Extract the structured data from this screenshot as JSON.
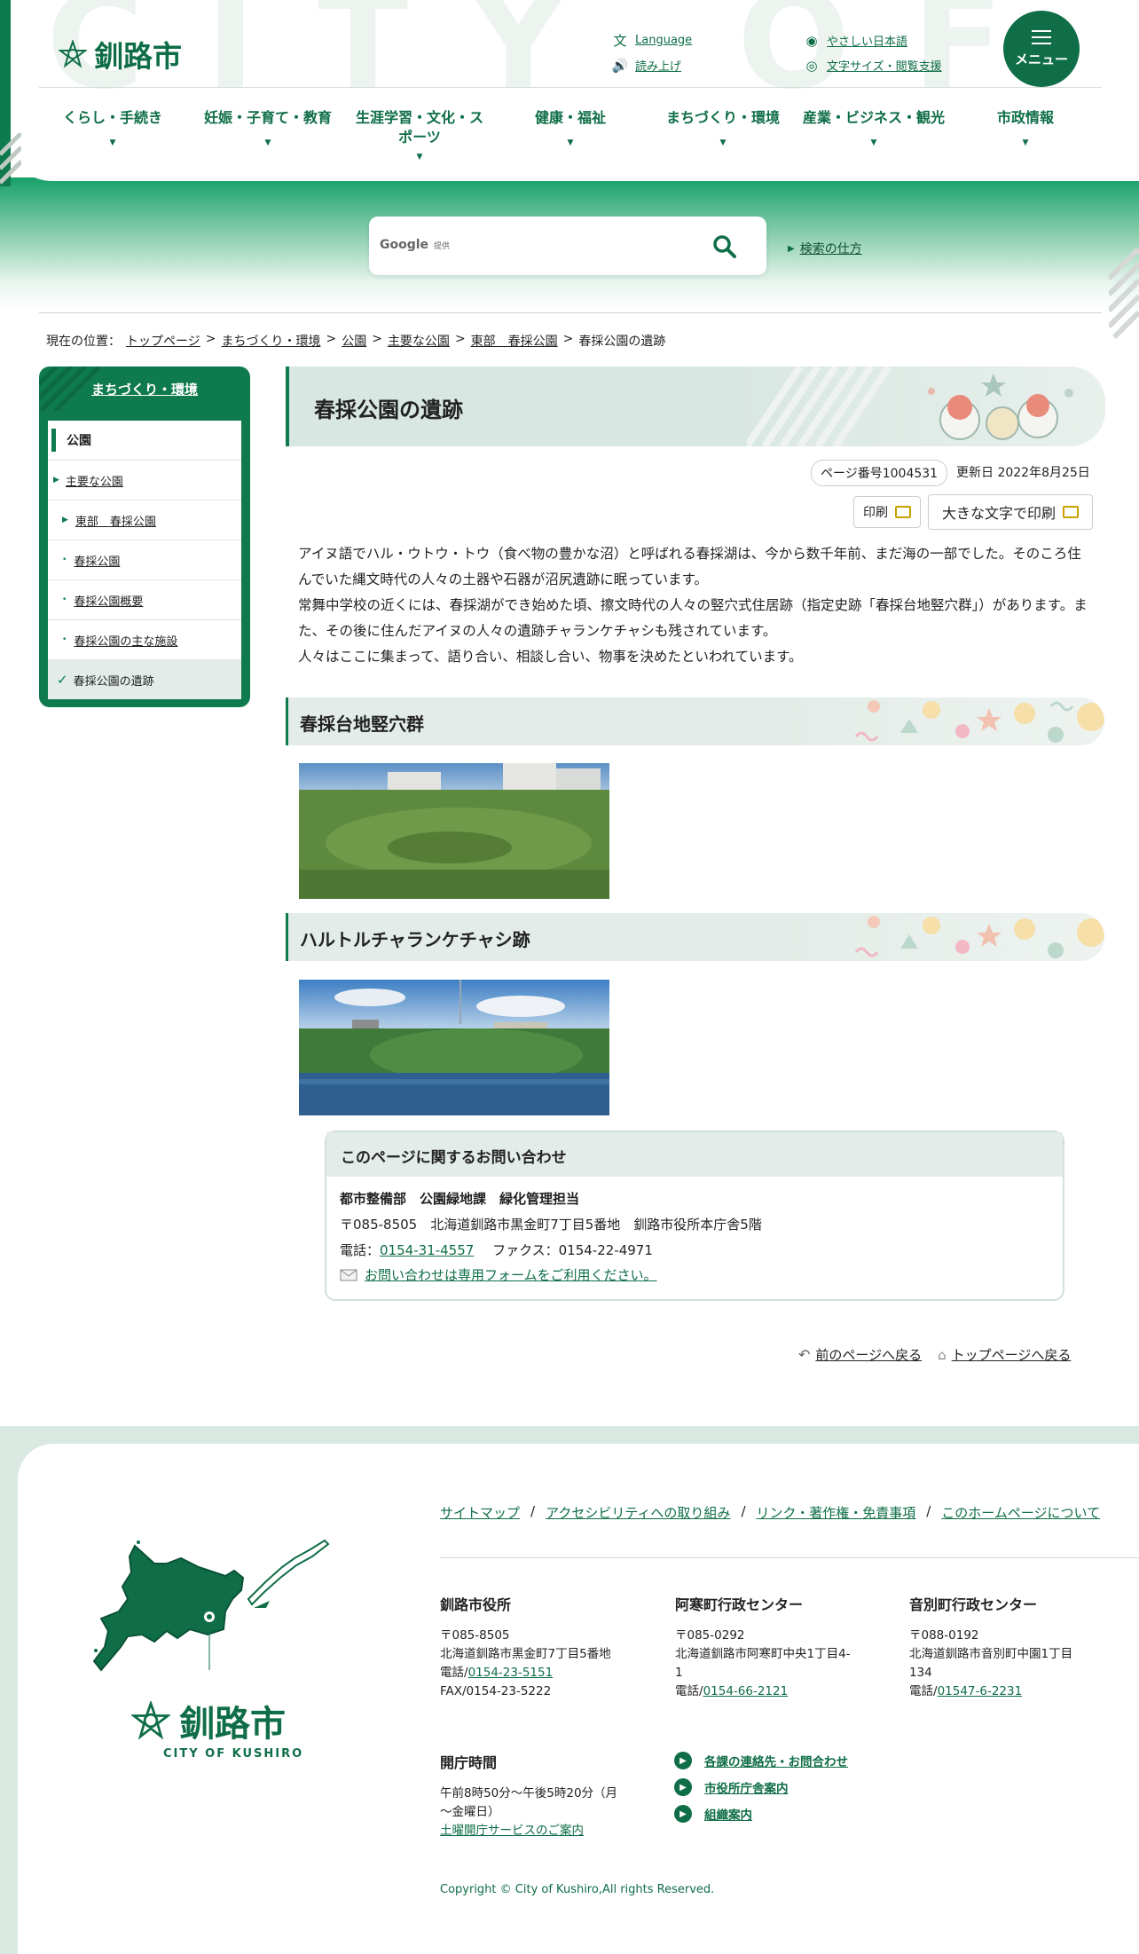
{
  "header": {
    "watermark": "CITY OF KUSHIRO",
    "logo_text": "釧路市",
    "language": "Language",
    "read_aloud": "読み上げ",
    "easy_japanese": "やさしい日本語",
    "font_size": "文字サイズ・閲覧支援",
    "menu_label": "メニュー"
  },
  "nav": [
    "くらし・手続き",
    "妊娠・子育て・教育",
    "生涯学習・文化・スポーツ",
    "健康・福祉",
    "まちづくり・環境",
    "産業・ビジネス・観光",
    "市政情報"
  ],
  "search": {
    "google": "Google",
    "provided": "提供",
    "how_to": "検索の仕方"
  },
  "breadcrumb": {
    "prefix": "現在の位置：",
    "items": [
      "トップページ",
      "まちづくり・環境",
      "公園",
      "主要な公園",
      "東部　春採公園"
    ],
    "current": "春採公園の遺跡"
  },
  "sidebar": {
    "title": "まちづくり・環境",
    "items": [
      {
        "label": "公園"
      },
      {
        "label": "主要な公園"
      },
      {
        "label": "東部　春採公園"
      },
      {
        "label": "春採公園"
      },
      {
        "label": "春採公園概要"
      },
      {
        "label": "春採公園の主な施設"
      },
      {
        "label": "春採公園の遺跡"
      }
    ]
  },
  "main": {
    "title": "春採公園の遺跡",
    "page_number": "ページ番号1004531",
    "updated": "更新日 2022年8月25日",
    "print": "印刷",
    "print_large": "大きな文字で印刷",
    "paragraphs": [
      "アイヌ語でハル・ウトウ・トウ（食べ物の豊かな沼）と呼ばれる春採湖は、今から数千年前、まだ海の一部でした。そのころ住んでいた縄文時代の人々の土器や石器が沼尻遺跡に眠っています。",
      "常舞中学校の近くには、春採湖ができ始めた頃、擦文時代の人々の竪穴式住居跡（指定史跡「春採台地竪穴群」）があります。また、その後に住んだアイヌの人々の遺跡チャランケチャシも残されています。",
      "人々はここに集まって、語り合い、相談し合い、物事を決めたといわれています。"
    ],
    "section1": "春採台地竪穴群",
    "section2": "ハルトルチャランケチャシ跡"
  },
  "contact": {
    "title": "このページに関するお問い合わせ",
    "dept": "都市整備部　公園緑地課　緑化管理担当",
    "address": "〒085-8505　北海道釧路市黒金町7丁目5番地　釧路市役所本庁舎5階",
    "tel_label": "電話：",
    "tel": "0154-31-4557",
    "fax": "ファクス：0154-22-4971",
    "form_link": "お問い合わせは専用フォームをご利用ください。"
  },
  "back": {
    "prev": "前のページへ戻る",
    "top": "トップページへ戻る"
  },
  "footer": {
    "links": [
      "サイトマップ",
      "アクセシビリティへの取り組み",
      "リンク・著作権・免責事項",
      "このホームページについて"
    ],
    "separator": "/",
    "city_name": "釧路市",
    "city_en": "CITY OF KUSHIRO",
    "office1": {
      "name": "釧路市役所",
      "zip": "〒085-8505",
      "address": "北海道釧路市黒金町7丁目5番地",
      "tel_label": "電話/",
      "tel": "0154-23-5151",
      "fax": "FAX/0154-23-5222"
    },
    "office2": {
      "name": "阿寒町行政センター",
      "zip": "〒085-0292",
      "address": "北海道釧路市阿寒町中央1丁目4-1",
      "tel_label": "電話/",
      "tel": "0154-66-2121"
    },
    "office3": {
      "name": "音別町行政センター",
      "zip": "〒088-0192",
      "address": "北海道釧路市音別町中園1丁目134",
      "tel_label": "電話/",
      "tel": "01547-6-2231"
    },
    "hours": {
      "title": "開庁時間",
      "text": "午前8時50分～午後5時20分（月～金曜日）",
      "link": "土曜開庁サービスのご案内"
    },
    "quick_links": [
      "各課の連絡先・お問合わせ",
      "市役所庁舎案内",
      "組織案内"
    ],
    "copyright": "Copyright © City of Kushiro,All rights Reserved."
  },
  "colors": {
    "brand": "#0f6e47",
    "accent_light": "#d9e7e2"
  }
}
